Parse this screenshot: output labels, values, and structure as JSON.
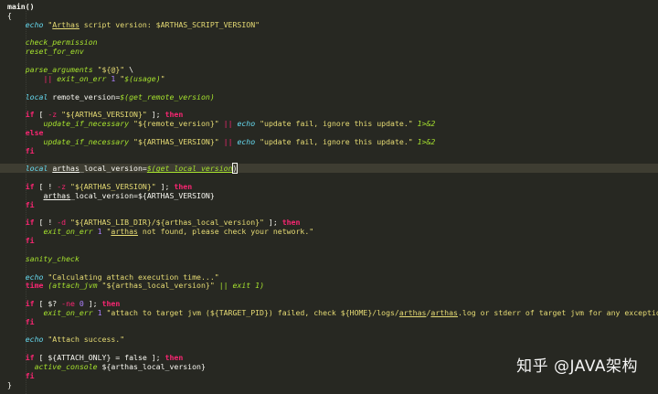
{
  "colors": {
    "background": "#272822",
    "current_line": "#3e3d32",
    "keyword": "#f92672",
    "function": "#a6e22e",
    "string": "#e6db74",
    "builtin": "#66d9ef",
    "text": "#f8f8f2"
  },
  "code_lines": [
    [
      [
        "def",
        "main()"
      ]
    ],
    [
      [
        "plain",
        "{"
      ]
    ],
    [
      [
        "plain",
        "    "
      ],
      [
        "builtin",
        "echo"
      ],
      [
        "str",
        " \""
      ],
      [
        "under",
        "Arthas"
      ],
      [
        "str",
        " script version: $ARTHAS_SCRIPT_VERSION\""
      ]
    ],
    [],
    [
      [
        "plain",
        "    "
      ],
      [
        "fn",
        "check_permission"
      ]
    ],
    [
      [
        "plain",
        "    "
      ],
      [
        "fn",
        "reset_for_env"
      ]
    ],
    [],
    [
      [
        "plain",
        "    "
      ],
      [
        "fn",
        "parse_arguments"
      ],
      [
        "str",
        " \"${@}\""
      ],
      [
        "plain",
        " \\"
      ]
    ],
    [
      [
        "plain",
        "        "
      ],
      [
        "op",
        "||"
      ],
      [
        "plain",
        " "
      ],
      [
        "fn",
        "exit_on_err"
      ],
      [
        "num",
        " 1"
      ],
      [
        "str",
        " \""
      ],
      [
        "fn",
        "$(usage)"
      ],
      [
        "str",
        "\""
      ]
    ],
    [],
    [
      [
        "plain",
        "    "
      ],
      [
        "builtin",
        "local"
      ],
      [
        "plain",
        " remote_version="
      ],
      [
        "fn",
        "$(get_remote_version)"
      ]
    ],
    [],
    [
      [
        "plain",
        "    "
      ],
      [
        "kw",
        "if"
      ],
      [
        "plain",
        " [ "
      ],
      [
        "op",
        "-z"
      ],
      [
        "str",
        " \"${ARTHAS_VERSION}\""
      ],
      [
        "plain",
        " ]; "
      ],
      [
        "kw",
        "then"
      ]
    ],
    [
      [
        "plain",
        "        "
      ],
      [
        "fn",
        "update_if_necessary"
      ],
      [
        "str",
        " \"${remote_version}\""
      ],
      [
        "plain",
        " "
      ],
      [
        "op",
        "||"
      ],
      [
        "plain",
        " "
      ],
      [
        "builtin",
        "echo"
      ],
      [
        "str",
        " \"update fail, ignore this update.\""
      ],
      [
        "plain",
        " "
      ],
      [
        "fn",
        "1>&2"
      ]
    ],
    [
      [
        "plain",
        "    "
      ],
      [
        "kw",
        "else"
      ]
    ],
    [
      [
        "plain",
        "        "
      ],
      [
        "fn",
        "update_if_necessary"
      ],
      [
        "str",
        " \"${ARTHAS_VERSION}\""
      ],
      [
        "plain",
        " "
      ],
      [
        "op",
        "||"
      ],
      [
        "plain",
        " "
      ],
      [
        "builtin",
        "echo"
      ],
      [
        "str",
        " \"update fail, ignore this update.\""
      ],
      [
        "plain",
        " "
      ],
      [
        "fn",
        "1>&2"
      ]
    ],
    [
      [
        "plain",
        "    "
      ],
      [
        "kw",
        "fi"
      ]
    ],
    [],
    [
      [
        "plain",
        "    "
      ],
      [
        "builtin",
        "local"
      ],
      [
        "plain",
        " "
      ],
      [
        "varunder",
        "arthas"
      ],
      [
        "plain",
        "_local_version="
      ],
      [
        "fnunder",
        "$(get_local_version"
      ],
      [
        "cursor",
        ")"
      ]
    ],
    [],
    [
      [
        "plain",
        "    "
      ],
      [
        "kw",
        "if"
      ],
      [
        "plain",
        " [ ! "
      ],
      [
        "op",
        "-z"
      ],
      [
        "str",
        " \"${ARTHAS_VERSION}\""
      ],
      [
        "plain",
        " ]; "
      ],
      [
        "kw",
        "then"
      ]
    ],
    [
      [
        "plain",
        "        "
      ],
      [
        "varunder",
        "arthas"
      ],
      [
        "plain",
        "_local_version=${ARTHAS_VERSION}"
      ]
    ],
    [
      [
        "plain",
        "    "
      ],
      [
        "kw",
        "fi"
      ]
    ],
    [],
    [
      [
        "plain",
        "    "
      ],
      [
        "kw",
        "if"
      ],
      [
        "plain",
        " [ ! "
      ],
      [
        "op",
        "-d"
      ],
      [
        "str",
        " \"${ARTHAS_LIB_DIR}/${arthas_local_version}\""
      ],
      [
        "plain",
        " ]; "
      ],
      [
        "kw",
        "then"
      ]
    ],
    [
      [
        "plain",
        "        "
      ],
      [
        "fn",
        "exit_on_err"
      ],
      [
        "num",
        " 1"
      ],
      [
        "str",
        " \""
      ],
      [
        "under",
        "arthas"
      ],
      [
        "str",
        " not found, please check your network.\""
      ]
    ],
    [
      [
        "plain",
        "    "
      ],
      [
        "kw",
        "fi"
      ]
    ],
    [],
    [
      [
        "plain",
        "    "
      ],
      [
        "fn",
        "sanity_check"
      ]
    ],
    [],
    [
      [
        "plain",
        "    "
      ],
      [
        "builtin",
        "echo"
      ],
      [
        "str",
        " \"Calculating attach execution time...\""
      ]
    ],
    [
      [
        "plain",
        "    "
      ],
      [
        "kw",
        "time"
      ],
      [
        "plain",
        " "
      ],
      [
        "fn",
        "(attach_jvm"
      ],
      [
        "str",
        " \"${arthas_local_version}\""
      ],
      [
        "plain",
        " "
      ],
      [
        "fn",
        "|| exit 1)"
      ]
    ],
    [],
    [
      [
        "plain",
        "    "
      ],
      [
        "kw",
        "if"
      ],
      [
        "plain",
        " [ $? "
      ],
      [
        "op",
        "-ne"
      ],
      [
        "num",
        " 0"
      ],
      [
        "plain",
        " ]; "
      ],
      [
        "kw",
        "then"
      ]
    ],
    [
      [
        "plain",
        "        "
      ],
      [
        "fn",
        "exit_on_err"
      ],
      [
        "num",
        " 1"
      ],
      [
        "str",
        " \"attach to target jvm (${TARGET_PID}) failed, check ${HOME}/logs/"
      ],
      [
        "under",
        "arthas"
      ],
      [
        "str",
        "/"
      ],
      [
        "under",
        "arthas"
      ],
      [
        "str",
        ".log or stderr of target jvm for any exceptions.\""
      ]
    ],
    [
      [
        "plain",
        "    "
      ],
      [
        "kw",
        "fi"
      ]
    ],
    [],
    [
      [
        "plain",
        "    "
      ],
      [
        "builtin",
        "echo"
      ],
      [
        "str",
        " \"Attach success.\""
      ]
    ],
    [],
    [
      [
        "plain",
        "    "
      ],
      [
        "kw",
        "if"
      ],
      [
        "plain",
        " [ ${ATTACH_ONLY} = false ]; "
      ],
      [
        "kw",
        "then"
      ]
    ],
    [
      [
        "plain",
        "      "
      ],
      [
        "fn",
        "active_console"
      ],
      [
        "plain",
        " ${arthas_local_version}"
      ]
    ],
    [
      [
        "plain",
        "    "
      ],
      [
        "kw",
        "fi"
      ]
    ],
    [
      [
        "plain",
        "}"
      ]
    ]
  ],
  "current_line_index": 18,
  "watermark": "知乎 @JAVA架构"
}
